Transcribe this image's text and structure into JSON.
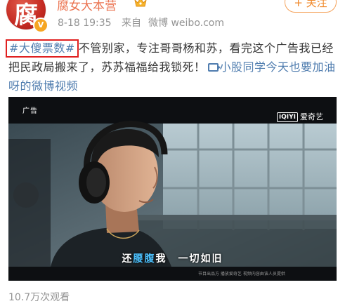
{
  "user": {
    "avatar_glyph": "腐",
    "name": "腐女大本营",
    "verified_badge": "V",
    "crown_icon": "crown-icon",
    "time": "8-18 19:35",
    "source_prefix": "来自",
    "source": "微博 weibo.com",
    "follow_label": "+ 关注"
  },
  "post": {
    "hashtag": "#大傻票数#",
    "text": "不管别家，专注哥哥杨和苏，看完这个广告我已经把民政局搬来了，苏苏福福给我锁死！",
    "video_link_icon": "video-icon",
    "video_link_text": "小股同学今天也要加油呀的微博视频"
  },
  "video": {
    "ad_label": "广告",
    "brand_mark": "iQIYI",
    "brand_name": "爱奇艺",
    "subtitle_before": "还",
    "subtitle_highlight": "腰腹",
    "subtitle_after": "我　一切如旧",
    "credits": "节目出品方  播放爱奇艺  视频内容由该人员提供"
  },
  "footer": {
    "views": "10.7万次观看"
  },
  "colors": {
    "username": "#eb7350",
    "link": "#507daf",
    "follow": "#f08a2c",
    "highlight_box": "#e02020",
    "meta": "#939393"
  }
}
